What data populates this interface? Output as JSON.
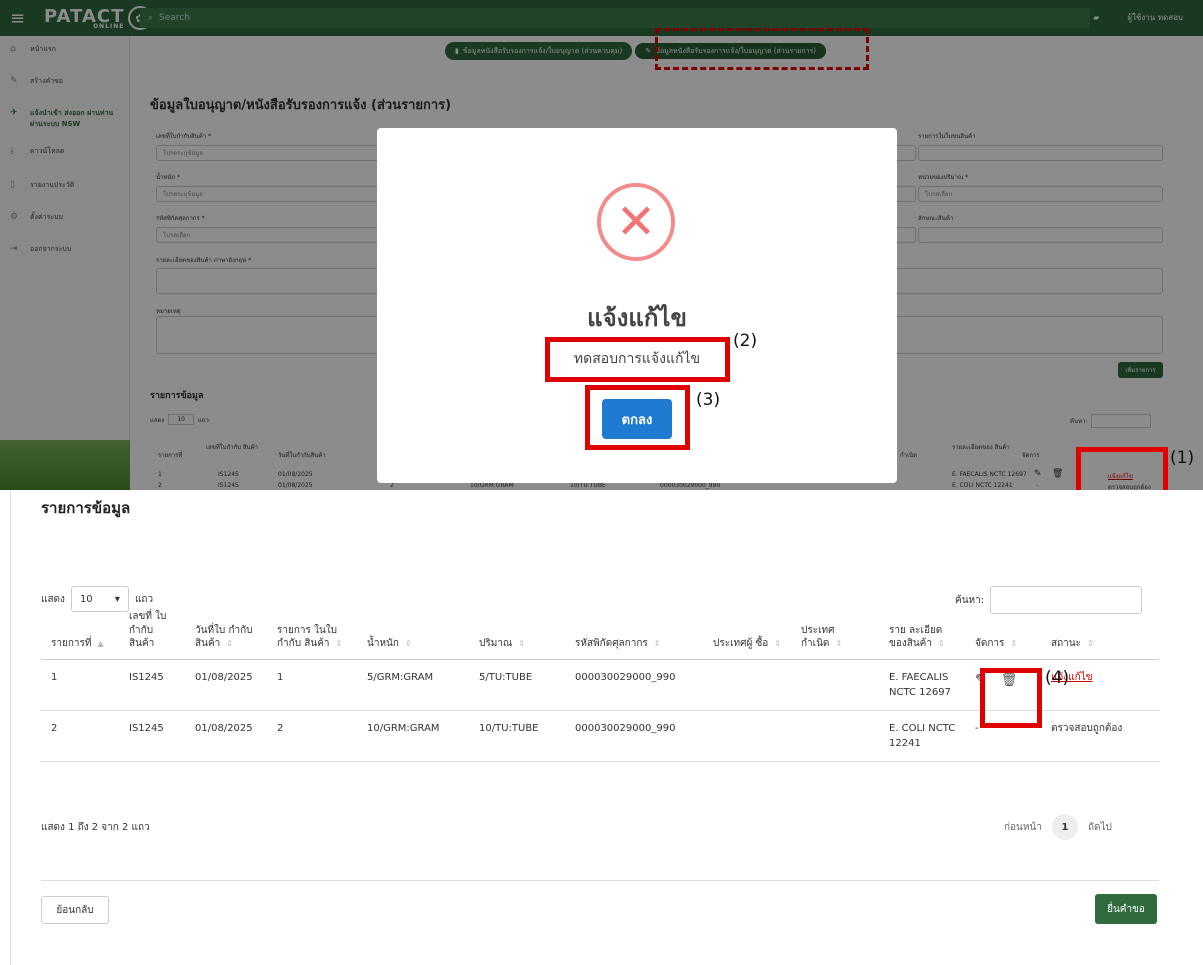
{
  "header": {
    "logo": "PATACT",
    "logo_sub": "ONLINE",
    "search_placeholder": "Search",
    "user": "ผู้ใช้งาน ทดสอบ"
  },
  "sidebar": {
    "items": [
      {
        "label": "หน้าแรก",
        "icon": "home-icon"
      },
      {
        "label": "สร้างคำขอ",
        "icon": "pen-icon"
      },
      {
        "label": "แจ้งนำเข้า ส่งออก ผ่านท่าน ผ่านระบบ NSW",
        "icon": "plane-icon"
      },
      {
        "label": "ดาวน์โหลด",
        "icon": "download-icon"
      },
      {
        "label": "รายงานประวัติ",
        "icon": "document-icon"
      },
      {
        "label": "ตั้งค่าระบบ",
        "icon": "gear-icon"
      },
      {
        "label": "ออกจากระบบ",
        "icon": "logout-icon"
      }
    ]
  },
  "steps": [
    {
      "label": "ข้อมูลหนังสือรับรองการแจ้ง/ใบอนุญาต (ส่วนควบคุม)"
    },
    {
      "label": "ข้อมูลหนังสือรับรองการแจ้ง/ใบอนุญาต (ส่วนรายการ)"
    }
  ],
  "form": {
    "title": "ข้อมูลใบอนุญาต/หนังสือรับรองการแจ้ง (ส่วนรายการ)",
    "field1_label": "เลขที่ใบกำกับสินค้า *",
    "field1_ph": "โปรดระบุข้อมูล",
    "field2_label": "น้ำหนัก *",
    "field2_ph": "โปรดระบุข้อมูล",
    "field3_label": "รหัสพิกัดศุลกากร *",
    "field3_ph": "โปรดเลือก",
    "field4_label": "รายละเอียดของสินค้า ภาษาอังกฤษ *",
    "field5_label": "หมายเหตุ",
    "right1_label": "รายการในใบขนสินค้า",
    "right2_label": "หน่วยของปริมาณ *",
    "right2_ph": "โปรดเลือก",
    "right3_label": "ลักษณะสินค้า",
    "add_button": "เพิ่มรายการ"
  },
  "top_table": {
    "title": "รายการข้อมูล",
    "show_label": "แสดง",
    "show_value": "10",
    "rows_label": "แถว",
    "search_label": "ค้นหา:",
    "headers": [
      "รายการที่",
      "เลขที่ใบกำกับ สินค้า",
      "วันที่ใบกำกับสินค้า",
      "กำเนิด",
      "รายละเอียดของ สินค้า",
      "จัดการ"
    ],
    "row1": [
      "1",
      "IS1245",
      "01/08/2025",
      "E. FAECALIS NCTC 12697",
      "แจ้งแก้ไข"
    ],
    "row2": [
      "2",
      "IS1245",
      "01/08/2025",
      "2",
      "10/GRM:GRAM",
      "10/TU:TUBE",
      "000030029000_990",
      "E. COLI NCTC 12241",
      "-",
      "ตรวจสอบถูกต้อง"
    ]
  },
  "modal": {
    "title": "แจ้งแก้ไข",
    "message": "ทดสอบการแจ้งแก้ไข",
    "ok_button": "ตกลง"
  },
  "callouts": {
    "c1": "(1)",
    "c2": "(2)",
    "c3": "(3)",
    "c4": "(4)"
  },
  "bottom": {
    "title": "รายการข้อมูล",
    "show_label": "แสดง",
    "show_value": "10",
    "rows_label": "แถว",
    "search_label": "ค้นหา:",
    "headers": [
      "รายการที่",
      "เลขที่ ใบ กำกับ สินค้า",
      "วันที่ใบ กำกับ สินค้า",
      "รายการ ในใบ กำกับ สินค้า",
      "น้ำหนัก",
      "ปริมาณ",
      "รหัสพิกัดศุลกากร",
      "ประเทศผู้ ซื้อ",
      "ประเทศ กำเนิด",
      "ราย ละเอียด ของสินค้า",
      "จัดการ",
      "สถานะ"
    ],
    "rows": [
      {
        "no": "1",
        "inv": "IS1245",
        "date": "01/08/2025",
        "item": "1",
        "weight": "5/GRM:GRAM",
        "qty": "5/TU:TUBE",
        "hs": "000030029000_990",
        "buyer": "",
        "origin": "",
        "desc": "E. FAECALIS NCTC 12697",
        "manage": "",
        "status": "แจ้งแก้ไข"
      },
      {
        "no": "2",
        "inv": "IS1245",
        "date": "01/08/2025",
        "item": "2",
        "weight": "10/GRM:GRAM",
        "qty": "10/TU:TUBE",
        "hs": "000030029000_990",
        "buyer": "",
        "origin": "",
        "desc": "E. COLI NCTC 12241",
        "manage": "-",
        "status": "ตรวจสอบถูกต้อง"
      }
    ],
    "info": "แสดง 1 ถึง 2 จาก 2 แถว",
    "prev": "ก่อนหน้า",
    "page": "1",
    "next": "ถัดไป",
    "back_button": "ย้อนกลับ",
    "submit_button": "ยื่นคำขอ"
  },
  "colors": {
    "brand": "#2f6b3c",
    "highlight": "#e00000",
    "ok": "#1f7ad1"
  }
}
